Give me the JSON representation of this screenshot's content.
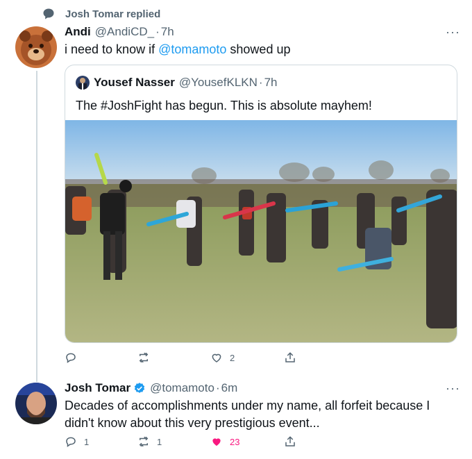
{
  "context": {
    "icon": "reply-bubble-icon",
    "text": "Josh Tomar replied"
  },
  "reply": {
    "name": "Andi",
    "handle": "@AndiCD_",
    "time": "7h",
    "text_before": "i need to know if ",
    "mention": "@tomamoto",
    "text_after": " showed up",
    "more": "···",
    "quote": {
      "name": "Yousef Nasser",
      "handle": "@YousefKLKN",
      "time": "7h",
      "text": "The #JoshFight has begun. This is absolute mayhem!"
    },
    "actions": {
      "reply_count": "",
      "retweet_count": "",
      "like_count": "2"
    }
  },
  "main": {
    "name": "Josh Tomar",
    "verified": true,
    "handle": "@tomamoto",
    "time": "6m",
    "text": "Decades of accomplishments under my name, all forfeit because I didn't know about this very prestigious event...",
    "more": "···",
    "actions": {
      "reply_count": "1",
      "retweet_count": "1",
      "like_count": "23",
      "liked": true
    }
  },
  "colors": {
    "accent": "#1d9bf0",
    "like": "#f91880",
    "muted": "#536471"
  }
}
